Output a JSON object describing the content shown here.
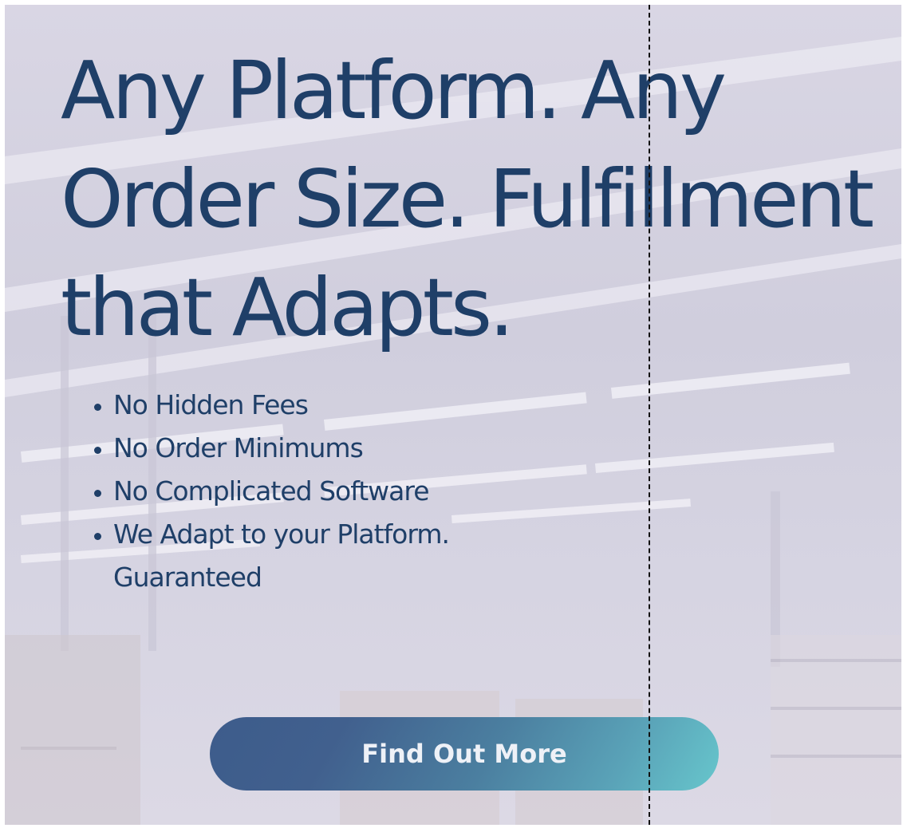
{
  "hero": {
    "headline": "Any Platform. Any Order Size. Fulfillment that Adapts.",
    "features": [
      "No Hidden Fees",
      "No Order Minimums",
      "No Complicated Software",
      "We Adapt to your Platform. Guaranteed"
    ],
    "cta_label": "Find Out More"
  },
  "colors": {
    "headline": "#1f3f68",
    "cta_gradient_start": "#3d5c8b",
    "cta_gradient_end": "#67c6cc",
    "overlay": "#d6d4e2"
  }
}
